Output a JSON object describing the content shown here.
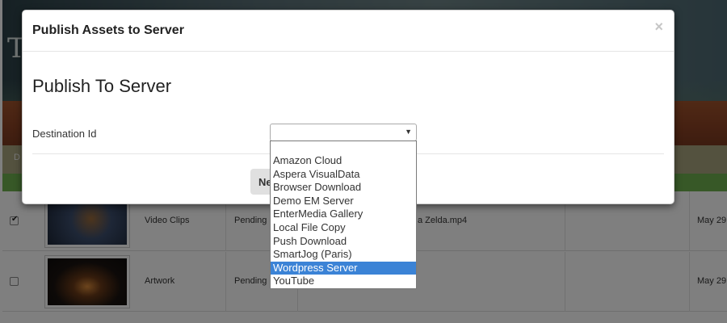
{
  "modal": {
    "title": "Publish Assets to Server",
    "close_glyph": "×",
    "section_title": "Publish To Server",
    "field_label": "Destination Id",
    "select_value": "",
    "select_arrow": "▼",
    "next_button_label": "Ne"
  },
  "dropdown": {
    "options": [
      "Amazon Cloud",
      "Aspera VisualData",
      "Browser Download",
      "Demo EM Server",
      "EnterMedia Gallery",
      "Local File Copy",
      "Push Download",
      "SmartJog (Paris)",
      "Wordpress Server",
      "YouTube"
    ],
    "highlighted_option": "Wordpress Server"
  },
  "background": {
    "hero_letter": "T",
    "bar_text": "D",
    "rows": [
      {
        "checked": true,
        "category": "Video Clips",
        "status": "Pending",
        "filename": "a Zelda.mp4",
        "date": "May 29"
      },
      {
        "checked": false,
        "category": "Artwork",
        "status": "Pending",
        "filename": "",
        "date": "May 29"
      }
    ]
  },
  "colors": {
    "selected_option_bg": "#3b83d6",
    "overlay": "rgba(0,0,0,0.5)",
    "green_bar": "#6fb04e"
  }
}
